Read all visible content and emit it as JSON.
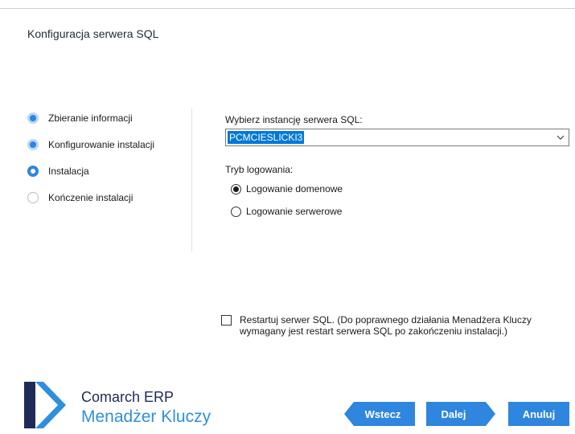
{
  "window": {
    "title": "Konfiguracja serwera SQL"
  },
  "steps": [
    {
      "label": "Zbieranie informacji",
      "state": "done"
    },
    {
      "label": "Konfigurowanie instalacji",
      "state": "done"
    },
    {
      "label": "Instalacja",
      "state": "current"
    },
    {
      "label": "Kończenie instalacji",
      "state": "todo"
    }
  ],
  "form": {
    "instance_label": "Wybierz instancję serwera SQL:",
    "instance_value": "PCMCIESLICKI3",
    "login_mode_label": "Tryb logowania:",
    "login_options": [
      {
        "label": "Logowanie domenowe",
        "selected": true
      },
      {
        "label": "Logowanie serwerowe",
        "selected": false
      }
    ],
    "restart_checked": false,
    "restart_text": "Restartuj serwer SQL. (Do poprawnego działania Menadżera Kluczy wymagany jest restart serwera SQL po zakończeniu instalacji.)"
  },
  "brand": {
    "line1": "Comarch ERP",
    "line2": "Menadżer Kluczy"
  },
  "buttons": {
    "back": "Wstecz",
    "next": "Dalej",
    "cancel": "Anuluj"
  },
  "colors": {
    "accent": "#2e86de",
    "brand_dark": "#1e2a5a",
    "selection": "#0078d7"
  },
  "icons": {
    "combo": "chevron-down-icon",
    "logo": "comarch-logo-icon"
  }
}
